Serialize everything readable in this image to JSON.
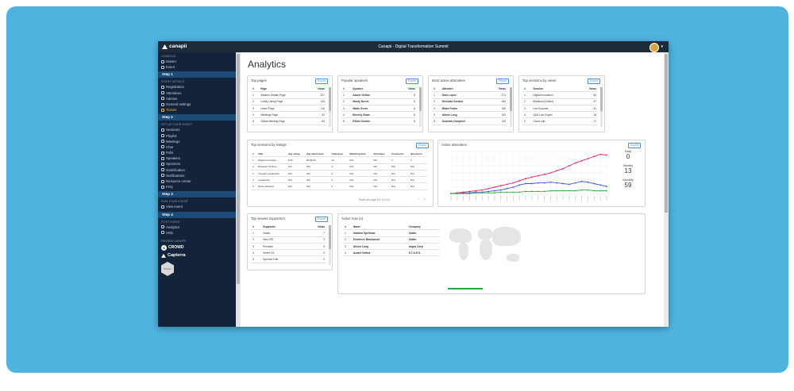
{
  "topbar": {
    "logo": "canapii",
    "title": "Canapii - Digital Transformation Summit"
  },
  "sidebar": {
    "console_label": "CONSOLE",
    "console_items": [
      "Master",
      "Event"
    ],
    "step1": {
      "label": "Step 1",
      "sub": "EVENT DETAILS",
      "items": [
        "Registration",
        "Attendees",
        "Admins",
        "General settings",
        "Tickets"
      ]
    },
    "step2": {
      "label": "Step 2",
      "sub": "SET UP YOUR EVENT",
      "items": [
        "Sessions",
        "Playlist",
        "Meetings",
        "Chat",
        "Polls",
        "Speakers",
        "Sponsors",
        "Gamification",
        "Notifications",
        "Resource center",
        "FAQ"
      ]
    },
    "step3": {
      "label": "Step 3",
      "sub": "RUN YOUR EVENT",
      "items": [
        "View event"
      ]
    },
    "step4": {
      "label": "Step 4",
      "sub": "POST EVENT",
      "items": [
        "Analytics",
        "Help"
      ]
    },
    "review_label": "REVIEW CANAPII",
    "g2": "CROWD",
    "capterra": "Capterra",
    "badge_text": "Partner"
  },
  "page": {
    "title": "Analytics"
  },
  "export_label": "Export",
  "top_pages": {
    "title": "Top pages",
    "headers": [
      "#",
      "Page",
      "Views"
    ],
    "rows": [
      [
        "1",
        "Session Details Page",
        "327"
      ],
      [
        "2",
        "Lobby Listing Page",
        "134"
      ],
      [
        "3",
        "Home Page",
        "116"
      ],
      [
        "4",
        "Meetings Page",
        "92"
      ],
      [
        "5",
        "Global Meeting Page",
        "83"
      ]
    ]
  },
  "popular_speakers": {
    "title": "Popular speakers",
    "headers": [
      "#",
      "Speaker",
      "Views"
    ],
    "rows": [
      [
        "1",
        "Azazel Geltos",
        "8"
      ],
      [
        "2",
        "Monty Norris",
        "6"
      ],
      [
        "3",
        "Wade Green",
        "6"
      ],
      [
        "4",
        "Beverly Shaw",
        "6"
      ],
      [
        "5",
        "Elliott Gordon",
        "6"
      ]
    ]
  },
  "active_attendees_list": {
    "title": "Most active attendees",
    "headers": [
      "#",
      "Attendee",
      "Views"
    ],
    "rows": [
      [
        "1",
        "Dave Lopez",
        "271"
      ],
      [
        "2",
        "Nicholas Scratch",
        "184"
      ],
      [
        "3",
        "Blake Foster",
        "160"
      ],
      [
        "4",
        "Alison Long",
        "152"
      ],
      [
        "5",
        "Deborah Campbell",
        "140"
      ]
    ]
  },
  "top_sessions_views": {
    "title": "Top sessions by views",
    "headers": [
      "#",
      "Session",
      "Views"
    ],
    "rows": [
      [
        "1",
        "Digital Innovation",
        "53"
      ],
      [
        "2",
        "Breakout (Online)",
        "37"
      ],
      [
        "3",
        "Live Keynote",
        "31"
      ],
      [
        "4",
        "Q&A Live Expert",
        "18"
      ],
      [
        "5",
        "Cloud Lab",
        "17"
      ]
    ]
  },
  "top_sessions_ratings": {
    "title": "Top sessions by ratings",
    "headers": [
      "#",
      "Title",
      "Avg rating",
      "Avg watch time",
      "Attendees",
      "Watching time",
      "Attendees",
      "Comments",
      "Questions"
    ],
    "rows": [
      [
        "1",
        "Digital Innovation",
        "5.00",
        "00:09:26",
        "10",
        "N/A",
        "N/A",
        "3",
        "3"
      ],
      [
        "2",
        "Breakout (Online)",
        "N/A",
        "N/A",
        "4",
        "N/A",
        "N/A",
        "N/A",
        "N/A"
      ],
      [
        "3",
        "Thought Leadership",
        "N/A",
        "N/A",
        "4",
        "N/A",
        "N/A",
        "N/A",
        "N/A"
      ],
      [
        "4",
        "Leadership",
        "N/A",
        "N/A",
        "3",
        "N/A",
        "N/A",
        "N/A",
        "N/A"
      ],
      [
        "5",
        "Demo Webinar",
        "N/A",
        "N/A",
        "3",
        "N/A",
        "N/A",
        "N/A",
        "N/A"
      ]
    ],
    "pagination": "Rows per page: 5  1–5 of 11",
    "page_next": "›",
    "page_last": "»"
  },
  "active_attendees_chart": {
    "title": "Active attendees",
    "stats": [
      {
        "label": "Daily",
        "value": "0"
      },
      {
        "label": "Weekly",
        "value": "13"
      },
      {
        "label": "Monthly",
        "value": "59"
      }
    ]
  },
  "chart_data": {
    "type": "line",
    "title": "Active attendees",
    "ylim": [
      0,
      60
    ],
    "x_count": 26,
    "series": [
      {
        "color": "#e2246b",
        "values": [
          1,
          2,
          3,
          4,
          5,
          6,
          8,
          10,
          12,
          14,
          16,
          19,
          22,
          24,
          26,
          28,
          30,
          33,
          36,
          40,
          44,
          47,
          50,
          53,
          56,
          55
        ]
      },
      {
        "color": "#3a5bd9",
        "values": [
          1,
          1,
          2,
          2,
          3,
          3,
          4,
          5,
          6,
          8,
          10,
          13,
          15,
          15,
          16,
          16,
          17,
          16,
          15,
          14,
          16,
          18,
          17,
          15,
          13,
          11
        ]
      },
      {
        "color": "#2bb24c",
        "values": [
          1,
          1,
          1,
          1,
          2,
          2,
          2,
          2,
          3,
          3,
          3,
          3,
          4,
          4,
          4,
          4,
          5,
          5,
          5,
          5,
          5,
          6,
          6,
          5,
          5,
          5
        ]
      }
    ]
  },
  "top_sponsors": {
    "title": "Top viewed supporters",
    "headers": [
      "#",
      "Supporter",
      "Views"
    ],
    "rows": [
      [
        "1",
        "Zadko",
        "7"
      ],
      [
        "2",
        "Nero IPE",
        "3"
      ],
      [
        "3",
        "Pinnacle",
        "3"
      ],
      [
        "4",
        "Vertel XG",
        "2"
      ],
      [
        "5",
        "Sponsor Unit",
        "2"
      ]
    ]
  },
  "active_now": {
    "title": "Active now (4)",
    "headers": [
      "#",
      "Name",
      "Company"
    ],
    "rows": [
      [
        "1",
        "Sabrina Spellman",
        "Zadko"
      ],
      [
        "2",
        "Prudence Blackwood",
        "Zadko"
      ],
      [
        "3",
        "Alison Long",
        "Argos Corp"
      ],
      [
        "4",
        "Azazel Geltos",
        "S.T.A.R.S."
      ]
    ]
  }
}
